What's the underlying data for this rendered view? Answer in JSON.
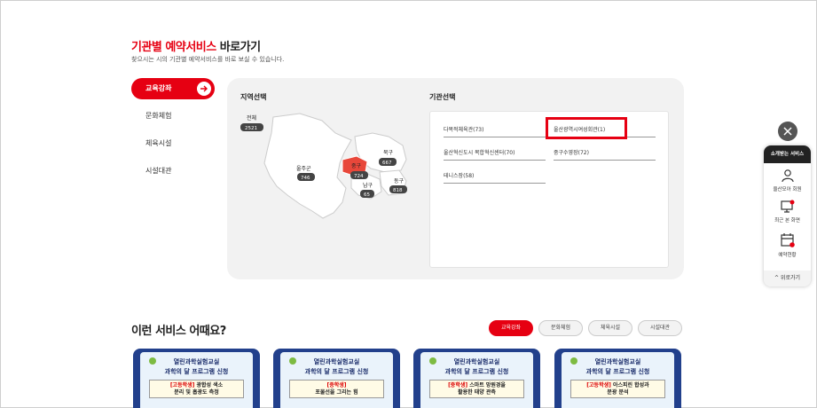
{
  "header": {
    "title_accent": "기관별 예약서비스",
    "title_rest": " 바로가기",
    "subtitle": "찾으시는 시의 기관별 예약서비스를 바로 보실 수 있습니다."
  },
  "sidebar": {
    "items": [
      {
        "label": "교육강좌"
      },
      {
        "label": "문화체험"
      },
      {
        "label": "체육시설"
      },
      {
        "label": "시설대관"
      }
    ]
  },
  "region": {
    "title": "지역선택",
    "districts": [
      {
        "name": "전체",
        "count": "2521"
      },
      {
        "name": "울주군",
        "count": "746"
      },
      {
        "name": "중구",
        "count": "724"
      },
      {
        "name": "북구",
        "count": "667"
      },
      {
        "name": "남구",
        "count": "65"
      },
      {
        "name": "동구",
        "count": "818"
      }
    ]
  },
  "institutions": {
    "title": "기관선택",
    "items": [
      {
        "label": "다목적체육관(73)"
      },
      {
        "label": "울산광역시여성회관(1)"
      },
      {
        "label": "울산혁신도시 복합혁신센터(70)"
      },
      {
        "label": "중구수영장(72)"
      },
      {
        "label": "테니스장(58)"
      }
    ]
  },
  "recommend": {
    "title": "이런 서비스 어때요?",
    "tabs": [
      {
        "label": "교육강좌"
      },
      {
        "label": "문화체험"
      },
      {
        "label": "체육시설"
      },
      {
        "label": "시설대관"
      }
    ],
    "cards": [
      {
        "line1": "열린과학실험교실",
        "line2": "과학의 달 프로그램 신청",
        "category": "[고등학생]",
        "desc1": " 광합성 색소",
        "desc2": "분리 및 흡광도 측정"
      },
      {
        "line1": "열린과학실험교실",
        "line2": "과학의 달 프로그램 신청",
        "category": "[중학생]",
        "desc1": "",
        "desc2": "포물선을 그리는 힘"
      },
      {
        "line1": "열린과학실험교실",
        "line2": "과학의 달 프로그램 신청",
        "category": "[중학생]",
        "desc1": " 스마트 망원경을",
        "desc2": "활용한 태양 관측"
      },
      {
        "line1": "열린과학실험교실",
        "line2": "과학의 달 프로그램 신청",
        "category": "[고등학생]",
        "desc1": " 아스피린 합성과",
        "desc2": "분광 분석"
      }
    ]
  },
  "floating": {
    "header": "소개받는 서비스",
    "items": [
      {
        "label": "울산모아 회원",
        "icon": "user-icon"
      },
      {
        "label": "최근 본 화면",
        "icon": "monitor-icon"
      },
      {
        "label": "예약현황",
        "icon": "calendar-icon"
      }
    ],
    "back": "위로가기"
  },
  "colors": {
    "accent": "#e60012",
    "card_bg": "#22408c"
  }
}
